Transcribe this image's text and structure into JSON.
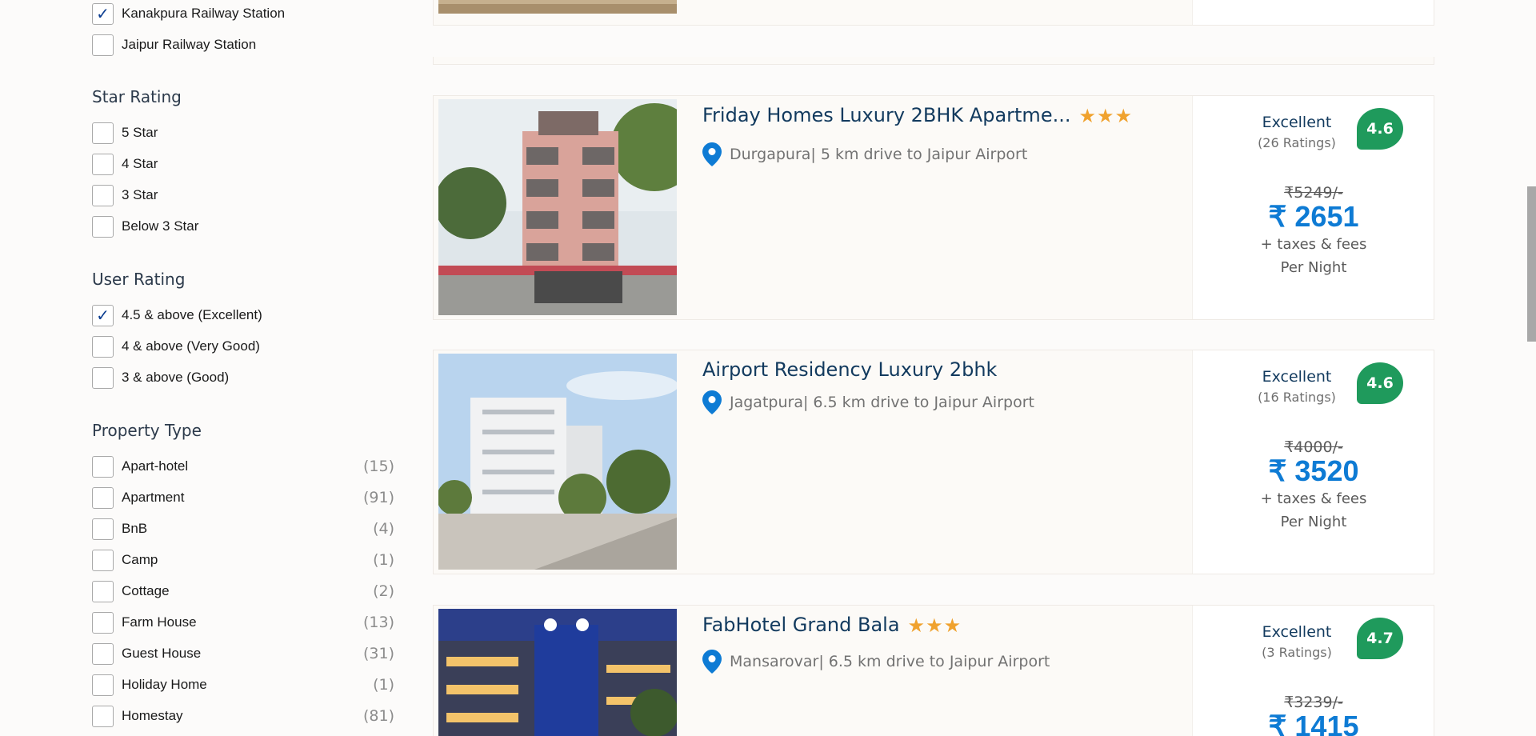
{
  "filters": {
    "station_options": [
      {
        "label": "Kanakpura Railway Station",
        "checked": true
      },
      {
        "label": "Jaipur Railway Station",
        "checked": false
      }
    ],
    "star_rating": {
      "title": "Star Rating",
      "options": [
        {
          "label": "5 Star",
          "checked": false
        },
        {
          "label": "4 Star",
          "checked": false
        },
        {
          "label": "3 Star",
          "checked": false
        },
        {
          "label": "Below 3 Star",
          "checked": false
        }
      ]
    },
    "user_rating": {
      "title": "User Rating",
      "options": [
        {
          "label": "4.5 & above (Excellent)",
          "checked": true
        },
        {
          "label": "4 & above (Very Good)",
          "checked": false
        },
        {
          "label": "3 & above (Good)",
          "checked": false
        }
      ]
    },
    "property_type": {
      "title": "Property Type",
      "options": [
        {
          "label": "Apart-hotel",
          "count": "(15)",
          "checked": false
        },
        {
          "label": "Apartment",
          "count": "(91)",
          "checked": false
        },
        {
          "label": "BnB",
          "count": "(4)",
          "checked": false
        },
        {
          "label": "Camp",
          "count": "(1)",
          "checked": false
        },
        {
          "label": "Cottage",
          "count": "(2)",
          "checked": false
        },
        {
          "label": "Farm House",
          "count": "(13)",
          "checked": false
        },
        {
          "label": "Guest House",
          "count": "(31)",
          "checked": false
        },
        {
          "label": "Holiday Home",
          "count": "(1)",
          "checked": false
        },
        {
          "label": "Homestay",
          "count": "(81)",
          "checked": false
        }
      ]
    }
  },
  "hotels": [
    {
      "name": "Friday Homes Luxury 2BHK Apartme...",
      "stars": 3,
      "location": "Durgapura| 5 km drive to Jaipur Airport",
      "rating_label": "Excellent",
      "rating_count": "(26 Ratings)",
      "score": "4.6",
      "old_price": "₹5249/-",
      "price": "₹ 2651",
      "taxes": "+ taxes & fees",
      "per_night": "Per Night"
    },
    {
      "name": "Airport Residency Luxury 2bhk",
      "stars": 0,
      "location": "Jagatpura| 6.5 km drive to Jaipur Airport",
      "rating_label": "Excellent",
      "rating_count": "(16 Ratings)",
      "score": "4.6",
      "old_price": "₹4000/-",
      "price": "₹ 3520",
      "taxes": "+ taxes & fees",
      "per_night": "Per Night"
    },
    {
      "name": "FabHotel Grand Bala",
      "stars": 3,
      "location": "Mansarovar| 6.5 km drive to Jaipur Airport",
      "rating_label": "Excellent",
      "rating_count": "(3 Ratings)",
      "score": "4.7",
      "old_price": "₹3239/-",
      "price": "₹ 1415",
      "taxes": "",
      "per_night": ""
    }
  ],
  "colors": {
    "accent_blue": "#0e7bd4",
    "rating_green": "#1f9a5c",
    "star_orange": "#f0a22e",
    "title_navy": "#123a5e"
  },
  "icons": {
    "checkbox_tick": "check-icon",
    "location": "map-pin-icon",
    "star": "star-icon"
  }
}
